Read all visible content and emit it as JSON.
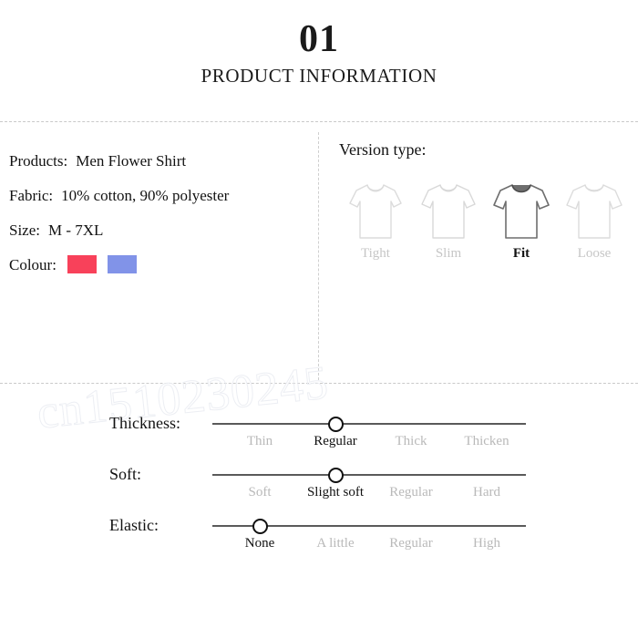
{
  "header": {
    "number": "01",
    "title": "PRODUCT INFORMATION"
  },
  "watermark": {
    "text": "cn1510230245"
  },
  "specs": {
    "rows": [
      {
        "label": "Products:",
        "value": "Men Flower Shirt"
      },
      {
        "label": "Fabric:",
        "value": "10% cotton, 90% polyester"
      },
      {
        "label": "Size:",
        "value": "M - 7XL"
      }
    ],
    "colour": {
      "label": "Colour:",
      "swatches": [
        {
          "name": "red",
          "hex": "#F8415A"
        },
        {
          "name": "blue",
          "hex": "#8193E8"
        }
      ]
    }
  },
  "version": {
    "heading": "Version type:",
    "options": [
      {
        "label": "Tight",
        "selected": false
      },
      {
        "label": "Slim",
        "selected": false
      },
      {
        "label": "Fit",
        "selected": true
      },
      {
        "label": "Loose",
        "selected": false
      }
    ]
  },
  "sliders": [
    {
      "label": "Thickness:",
      "ticks": [
        "Thin",
        "Regular",
        "Thick",
        "Thicken"
      ],
      "selected_index": 1
    },
    {
      "label": "Soft:",
      "ticks": [
        "Soft",
        "Slight soft",
        "Regular",
        "Hard"
      ],
      "selected_index": 1
    },
    {
      "label": "Elastic:",
      "ticks": [
        "None",
        "A little",
        "Regular",
        "High"
      ],
      "selected_index": 0
    }
  ]
}
